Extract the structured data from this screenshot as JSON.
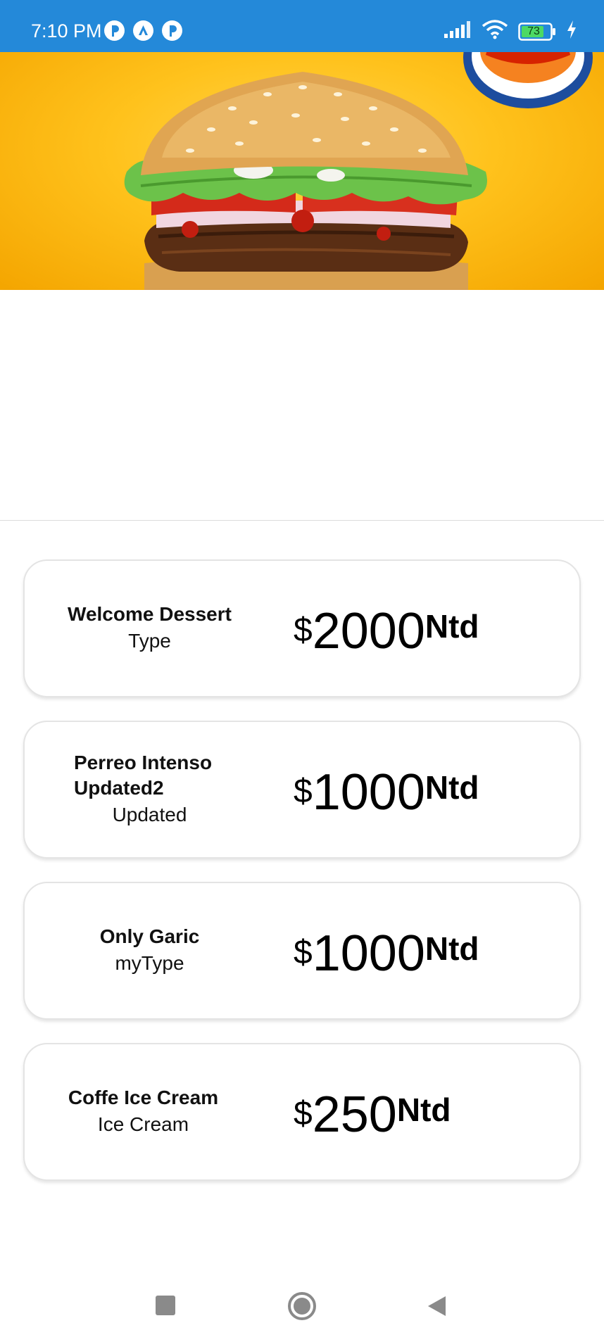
{
  "status_bar": {
    "time": "7:10 PM",
    "battery": "73",
    "icons": [
      "p-circle-icon",
      "arrow-up-circle-icon",
      "p-circle-icon",
      "signal-icon",
      "wifi-icon",
      "battery-icon",
      "charging-icon"
    ]
  },
  "banner": {
    "image": "burger-banner"
  },
  "products": [
    {
      "name": "Welcome Dessert",
      "type": "Type",
      "symbol": "$",
      "amount": "2000",
      "unit": "Ntd"
    },
    {
      "name": "Perreo Intenso Updated2",
      "type": "Updated",
      "symbol": "$",
      "amount": "1000",
      "unit": "Ntd"
    },
    {
      "name": "Only Garic",
      "type": "myType",
      "symbol": "$",
      "amount": "1000",
      "unit": "Ntd"
    },
    {
      "name": "Coffe Ice Cream",
      "type": "Ice Cream",
      "symbol": "$",
      "amount": "250",
      "unit": "Ntd"
    }
  ],
  "nav_bar": {
    "icons": [
      "recents-square-icon",
      "home-circle-icon",
      "back-triangle-icon"
    ]
  },
  "colors": {
    "status_bar": "#2489d9",
    "banner_bg": "#ffc21c",
    "card_border": "#e4e4e4"
  }
}
